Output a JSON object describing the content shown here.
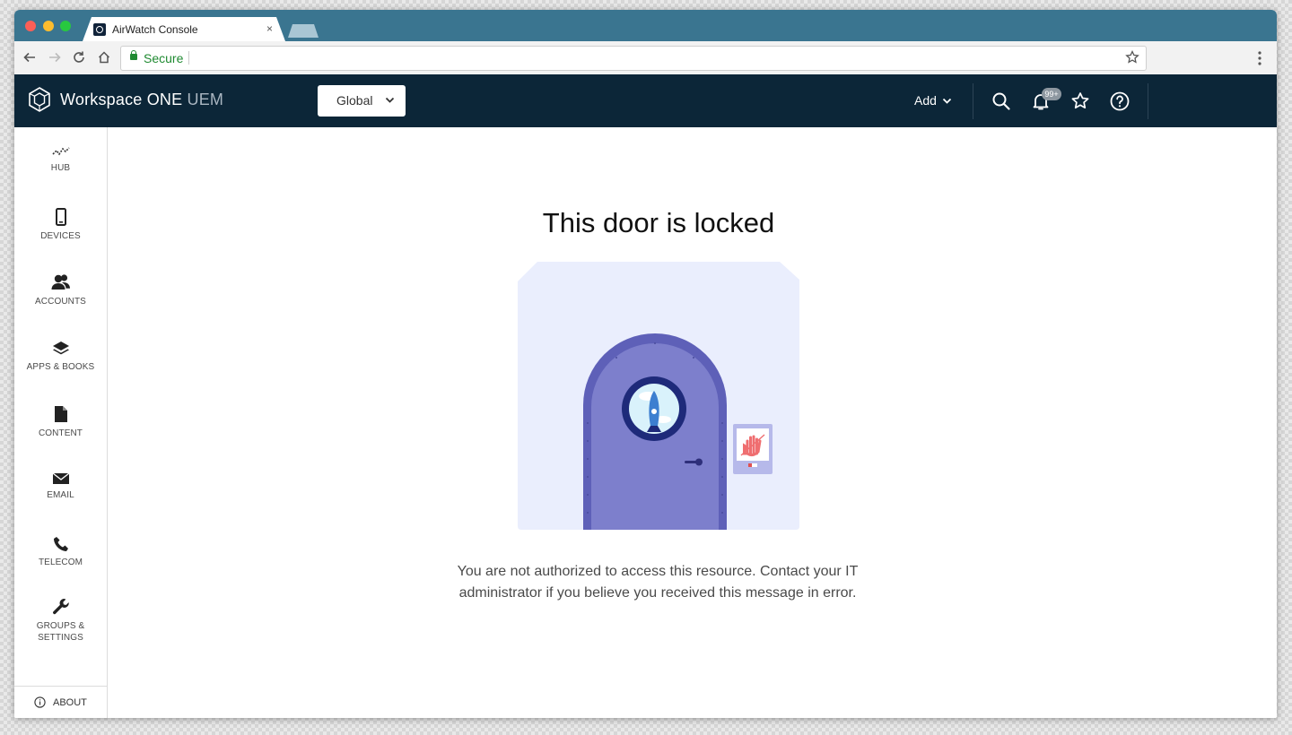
{
  "browser": {
    "tab_title": "AirWatch Console",
    "tab_close": "×",
    "security_label": "Secure"
  },
  "header": {
    "brand_name": "Workspace ONE",
    "brand_suffix": "UEM",
    "org_selector": "Global",
    "add_label": "Add",
    "notification_count": "99+"
  },
  "sidebar": {
    "items": [
      {
        "label": "HUB",
        "icon": "hub-icon"
      },
      {
        "label": "DEVICES",
        "icon": "device-icon"
      },
      {
        "label": "ACCOUNTS",
        "icon": "users-icon"
      },
      {
        "label": "APPS & BOOKS",
        "icon": "layers-icon"
      },
      {
        "label": "CONTENT",
        "icon": "document-icon"
      },
      {
        "label": "EMAIL",
        "icon": "envelope-icon"
      },
      {
        "label": "TELECOM",
        "icon": "phone-icon"
      },
      {
        "label": "GROUPS & SETTINGS",
        "icon": "wrench-icon"
      }
    ],
    "about": "ABOUT"
  },
  "main": {
    "title": "This door is locked",
    "message": "You are not authorized to access this resource. Contact your IT administrator if you believe you received this message in error."
  },
  "colors": {
    "browser_chrome": "#3a7590",
    "app_header": "#0c2638",
    "secure_green": "#1f8a31",
    "door": "#7d7fcc",
    "illustration_bg": "#eaeefd"
  }
}
